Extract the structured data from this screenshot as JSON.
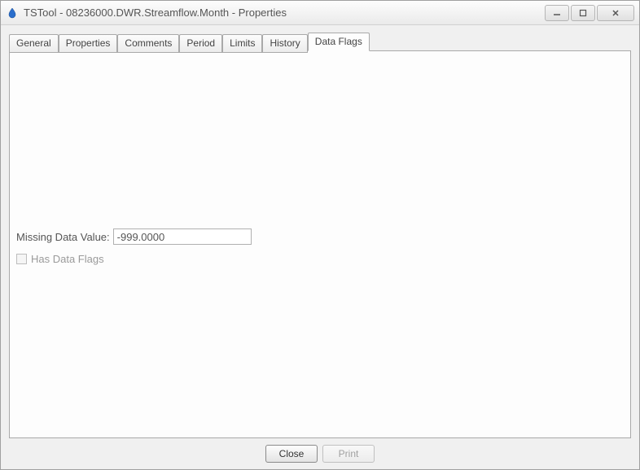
{
  "window": {
    "title": "TSTool - 08236000.DWR.Streamflow.Month - Properties"
  },
  "tabs": {
    "items": [
      {
        "label": "General"
      },
      {
        "label": "Properties"
      },
      {
        "label": "Comments"
      },
      {
        "label": "Period"
      },
      {
        "label": "Limits"
      },
      {
        "label": "History"
      },
      {
        "label": "Data Flags"
      }
    ],
    "active_index": 6
  },
  "form": {
    "missing_data_label": "Missing Data Value:",
    "missing_data_value": "-999.0000",
    "has_data_flags_label": "Has Data Flags",
    "has_data_flags_checked": false
  },
  "buttons": {
    "close": "Close",
    "print": "Print"
  }
}
